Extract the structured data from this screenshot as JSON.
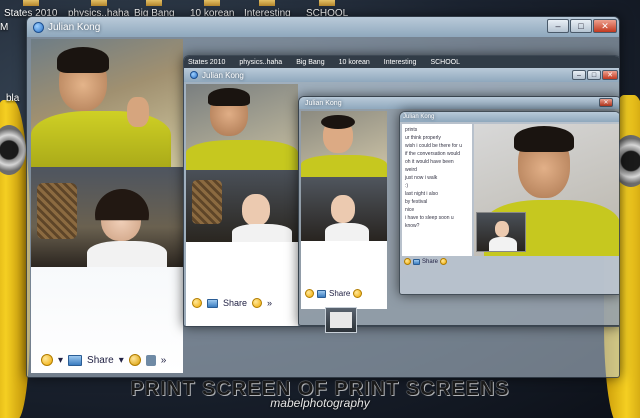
{
  "desktop": {
    "shortcuts": [
      "States 2010",
      "physics..haha",
      "Big Bang",
      "10 korean",
      "Interesting",
      "SCHOOL"
    ],
    "left_text_1": "M",
    "left_text_2": "bla"
  },
  "outer_window": {
    "title": "Julian Kong",
    "toolbar": {
      "share_label": "Share"
    }
  },
  "middle_window": {
    "title": "Julian Kong",
    "shortcuts": [
      "States 2010",
      "physics..haha",
      "Big Bang",
      "10 korean",
      "Interesting",
      "SCHOOL"
    ],
    "toolbar": {
      "share_label": "Share"
    }
  },
  "inner_window": {
    "title": "Julian Kong",
    "toolbar": {
      "share_label": "Share"
    }
  },
  "innermost_window": {
    "title": "Julian Kong",
    "chat_lines": [
      "prints",
      "ur think properly",
      "wish i could be there for u",
      "if the conversation would",
      "oh it would have been",
      "weird",
      "just now i walk",
      ":)",
      "last night i also",
      "by festival",
      "nice",
      "i have to sleep soon u know?"
    ],
    "toolbar": {
      "share_label": "Share"
    }
  },
  "caption": {
    "title": "PRINT SCREEN OF PRINT SCREENS",
    "watermark": "mabelphotography"
  },
  "colors": {
    "accent": "#3a7cc0",
    "title_bar": "#8fa8bd",
    "shirt": "#c8c81e"
  }
}
